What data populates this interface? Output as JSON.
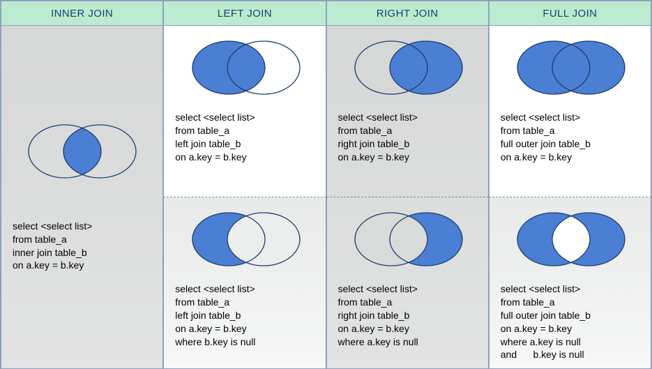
{
  "headers": {
    "inner": "INNER JOIN",
    "left": "LEFT JOIN",
    "right": "RIGHT JOIN",
    "full": "FULL JOIN"
  },
  "sql": {
    "inner": "select <select list>\nfrom table_a\ninner join table_b\non a.key = b.key",
    "left_top": "select <select list>\nfrom table_a\nleft join table_b\non a.key = b.key",
    "left_bot": "select <select list>\nfrom table_a\nleft join table_b\non a.key = b.key\nwhere b.key is null",
    "right_top": "select <select list>\nfrom table_a\nright join table_b\non a.key = b.key",
    "right_bot": "select <select list>\nfrom table_a\nright join table_b\non a.key = b.key\nwhere a.key is null",
    "full_top": "select <select list>\nfrom table_a\nfull outer join table_b\non a.key = b.key",
    "full_bot": "select <select list>\nfrom table_a\nfull outer join table_b\non a.key = b.key\nwhere a.key is null\nand      b.key is null"
  },
  "colors": {
    "fill": "#4a7fd4",
    "stroke": "#1a3d6b",
    "shaded_bg": "#d6d7d7"
  }
}
